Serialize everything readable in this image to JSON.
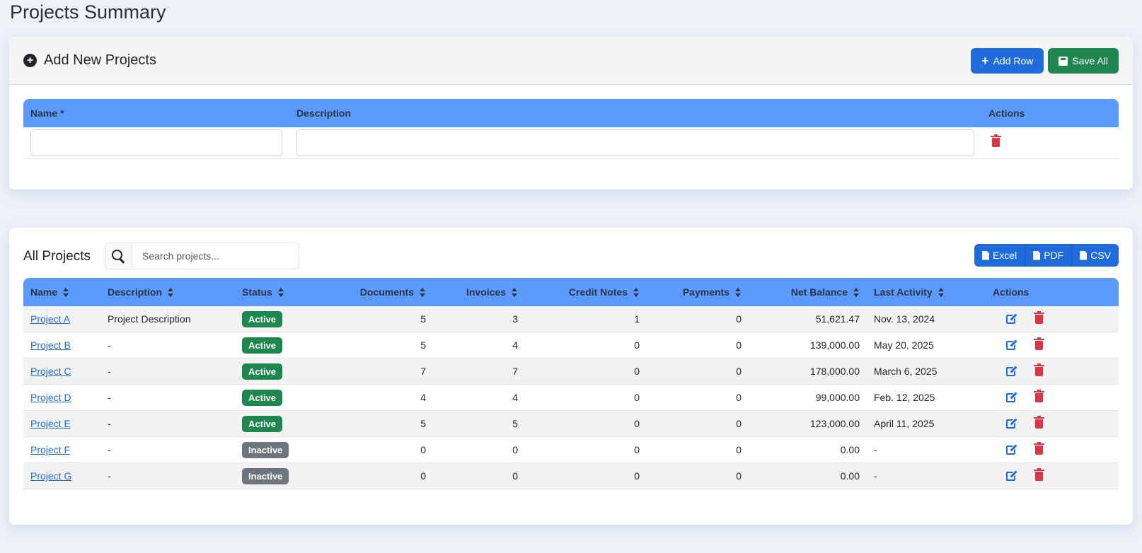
{
  "page": {
    "title": "Projects Summary"
  },
  "add_card": {
    "title": "Add New Projects",
    "add_row_label": "Add Row",
    "save_all_label": "Save All",
    "columns": {
      "name": "Name *",
      "description": "Description",
      "actions": "Actions"
    },
    "row": {
      "name_value": "",
      "description_value": ""
    }
  },
  "all_card": {
    "title": "All Projects",
    "search_placeholder": "Search projects...",
    "export": {
      "excel": "Excel",
      "pdf": "PDF",
      "csv": "CSV"
    },
    "columns": {
      "name": "Name",
      "description": "Description",
      "status": "Status",
      "documents": "Documents",
      "invoices": "Invoices",
      "credit_notes": "Credit Notes",
      "payments": "Payments",
      "net_balance": "Net Balance",
      "last_activity": "Last Activity",
      "actions": "Actions"
    },
    "rows": [
      {
        "name": "Project A",
        "description": "Project Description",
        "status": "Active",
        "documents": "5",
        "invoices": "3",
        "credit_notes": "1",
        "payments": "0",
        "net_balance": "51,621.47",
        "last_activity": "Nov. 13, 2024"
      },
      {
        "name": "Project B",
        "description": "-",
        "status": "Active",
        "documents": "5",
        "invoices": "4",
        "credit_notes": "0",
        "payments": "0",
        "net_balance": "139,000.00",
        "last_activity": "May 20, 2025"
      },
      {
        "name": "Project C",
        "description": "-",
        "status": "Active",
        "documents": "7",
        "invoices": "7",
        "credit_notes": "0",
        "payments": "0",
        "net_balance": "178,000.00",
        "last_activity": "March 6, 2025"
      },
      {
        "name": "Project D",
        "description": "-",
        "status": "Active",
        "documents": "4",
        "invoices": "4",
        "credit_notes": "0",
        "payments": "0",
        "net_balance": "99,000.00",
        "last_activity": "Feb. 12, 2025"
      },
      {
        "name": "Project E",
        "description": "-",
        "status": "Active",
        "documents": "5",
        "invoices": "5",
        "credit_notes": "0",
        "payments": "0",
        "net_balance": "123,000.00",
        "last_activity": "April 11, 2025"
      },
      {
        "name": "Project F",
        "description": "-",
        "status": "Inactive",
        "documents": "0",
        "invoices": "0",
        "credit_notes": "0",
        "payments": "0",
        "net_balance": "0.00",
        "last_activity": "-"
      },
      {
        "name": "Project G",
        "description": "-",
        "status": "Inactive",
        "documents": "0",
        "invoices": "0",
        "credit_notes": "0",
        "payments": "0",
        "net_balance": "0.00",
        "last_activity": "-"
      }
    ]
  },
  "icons": {
    "add_card_header": "plus-circle-icon",
    "add_row": "plus-icon",
    "save_all": "save-icon",
    "row_delete": "trash-icon",
    "search": "search-icon",
    "excel": "file-excel-icon",
    "pdf": "file-pdf-icon",
    "csv": "file-csv-icon",
    "sort": "sort-icon",
    "edit": "edit-icon",
    "delete": "trash-icon"
  },
  "colors": {
    "primary": "#1f6bdb",
    "success": "#1e8750",
    "danger": "#dc3545",
    "table_header": "#5b9bff",
    "inactive": "#6c757d"
  }
}
